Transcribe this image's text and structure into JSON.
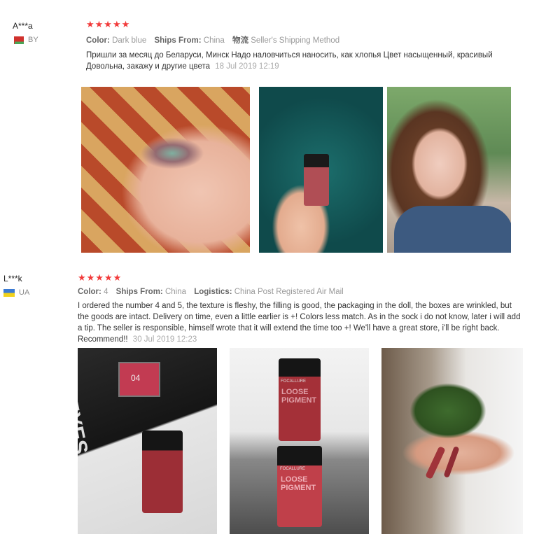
{
  "reviews": [
    {
      "user": "A***a",
      "country": "BY",
      "rating": "★★★★★",
      "meta": {
        "color_label": "Color:",
        "color_value": "Dark blue",
        "ships_label": "Ships From:",
        "ships_value": "China",
        "extra_label": "物流",
        "extra_value": "Seller's Shipping Method"
      },
      "text": "Пришли за месяц до Беларуси, Минск Надо наловчиться наносить, как хлопья Цвет насыщенный, красивый Довольна, закажу и другие цвета",
      "date": "18 Jul 2019 12:19"
    },
    {
      "user": "L***k",
      "country": "UA",
      "rating": "★★★★★",
      "meta": {
        "color_label": "Color:",
        "color_value": "4",
        "ships_label": "Ships From:",
        "ships_value": "China",
        "extra_label": "Logistics:",
        "extra_value": "China Post Registered Air Mail"
      },
      "text": "I ordered the number 4 and 5, the texture is fleshy, the filling is good, the packaging in the doll, the boxes are wrinkled, but the goods are intact. Delivery on time, even a little earlier is +! Colors less match. As in the sock i do not know, later i will add a tip. The seller is responsible, himself wrote that it will extend the time too +! We'll have a great store, i'll be right back. Recommend!!",
      "date": "30 Jul 2019 12:23"
    }
  ],
  "photos": {
    "swatch_number": "04",
    "jar_brand": "FOCALLURE",
    "jar_label": "LOOSE PIGMENT",
    "box_text": "EYES"
  },
  "colors": {
    "star": "#f23b3b",
    "meta_muted": "#999999",
    "date": "#aaaaaa"
  }
}
